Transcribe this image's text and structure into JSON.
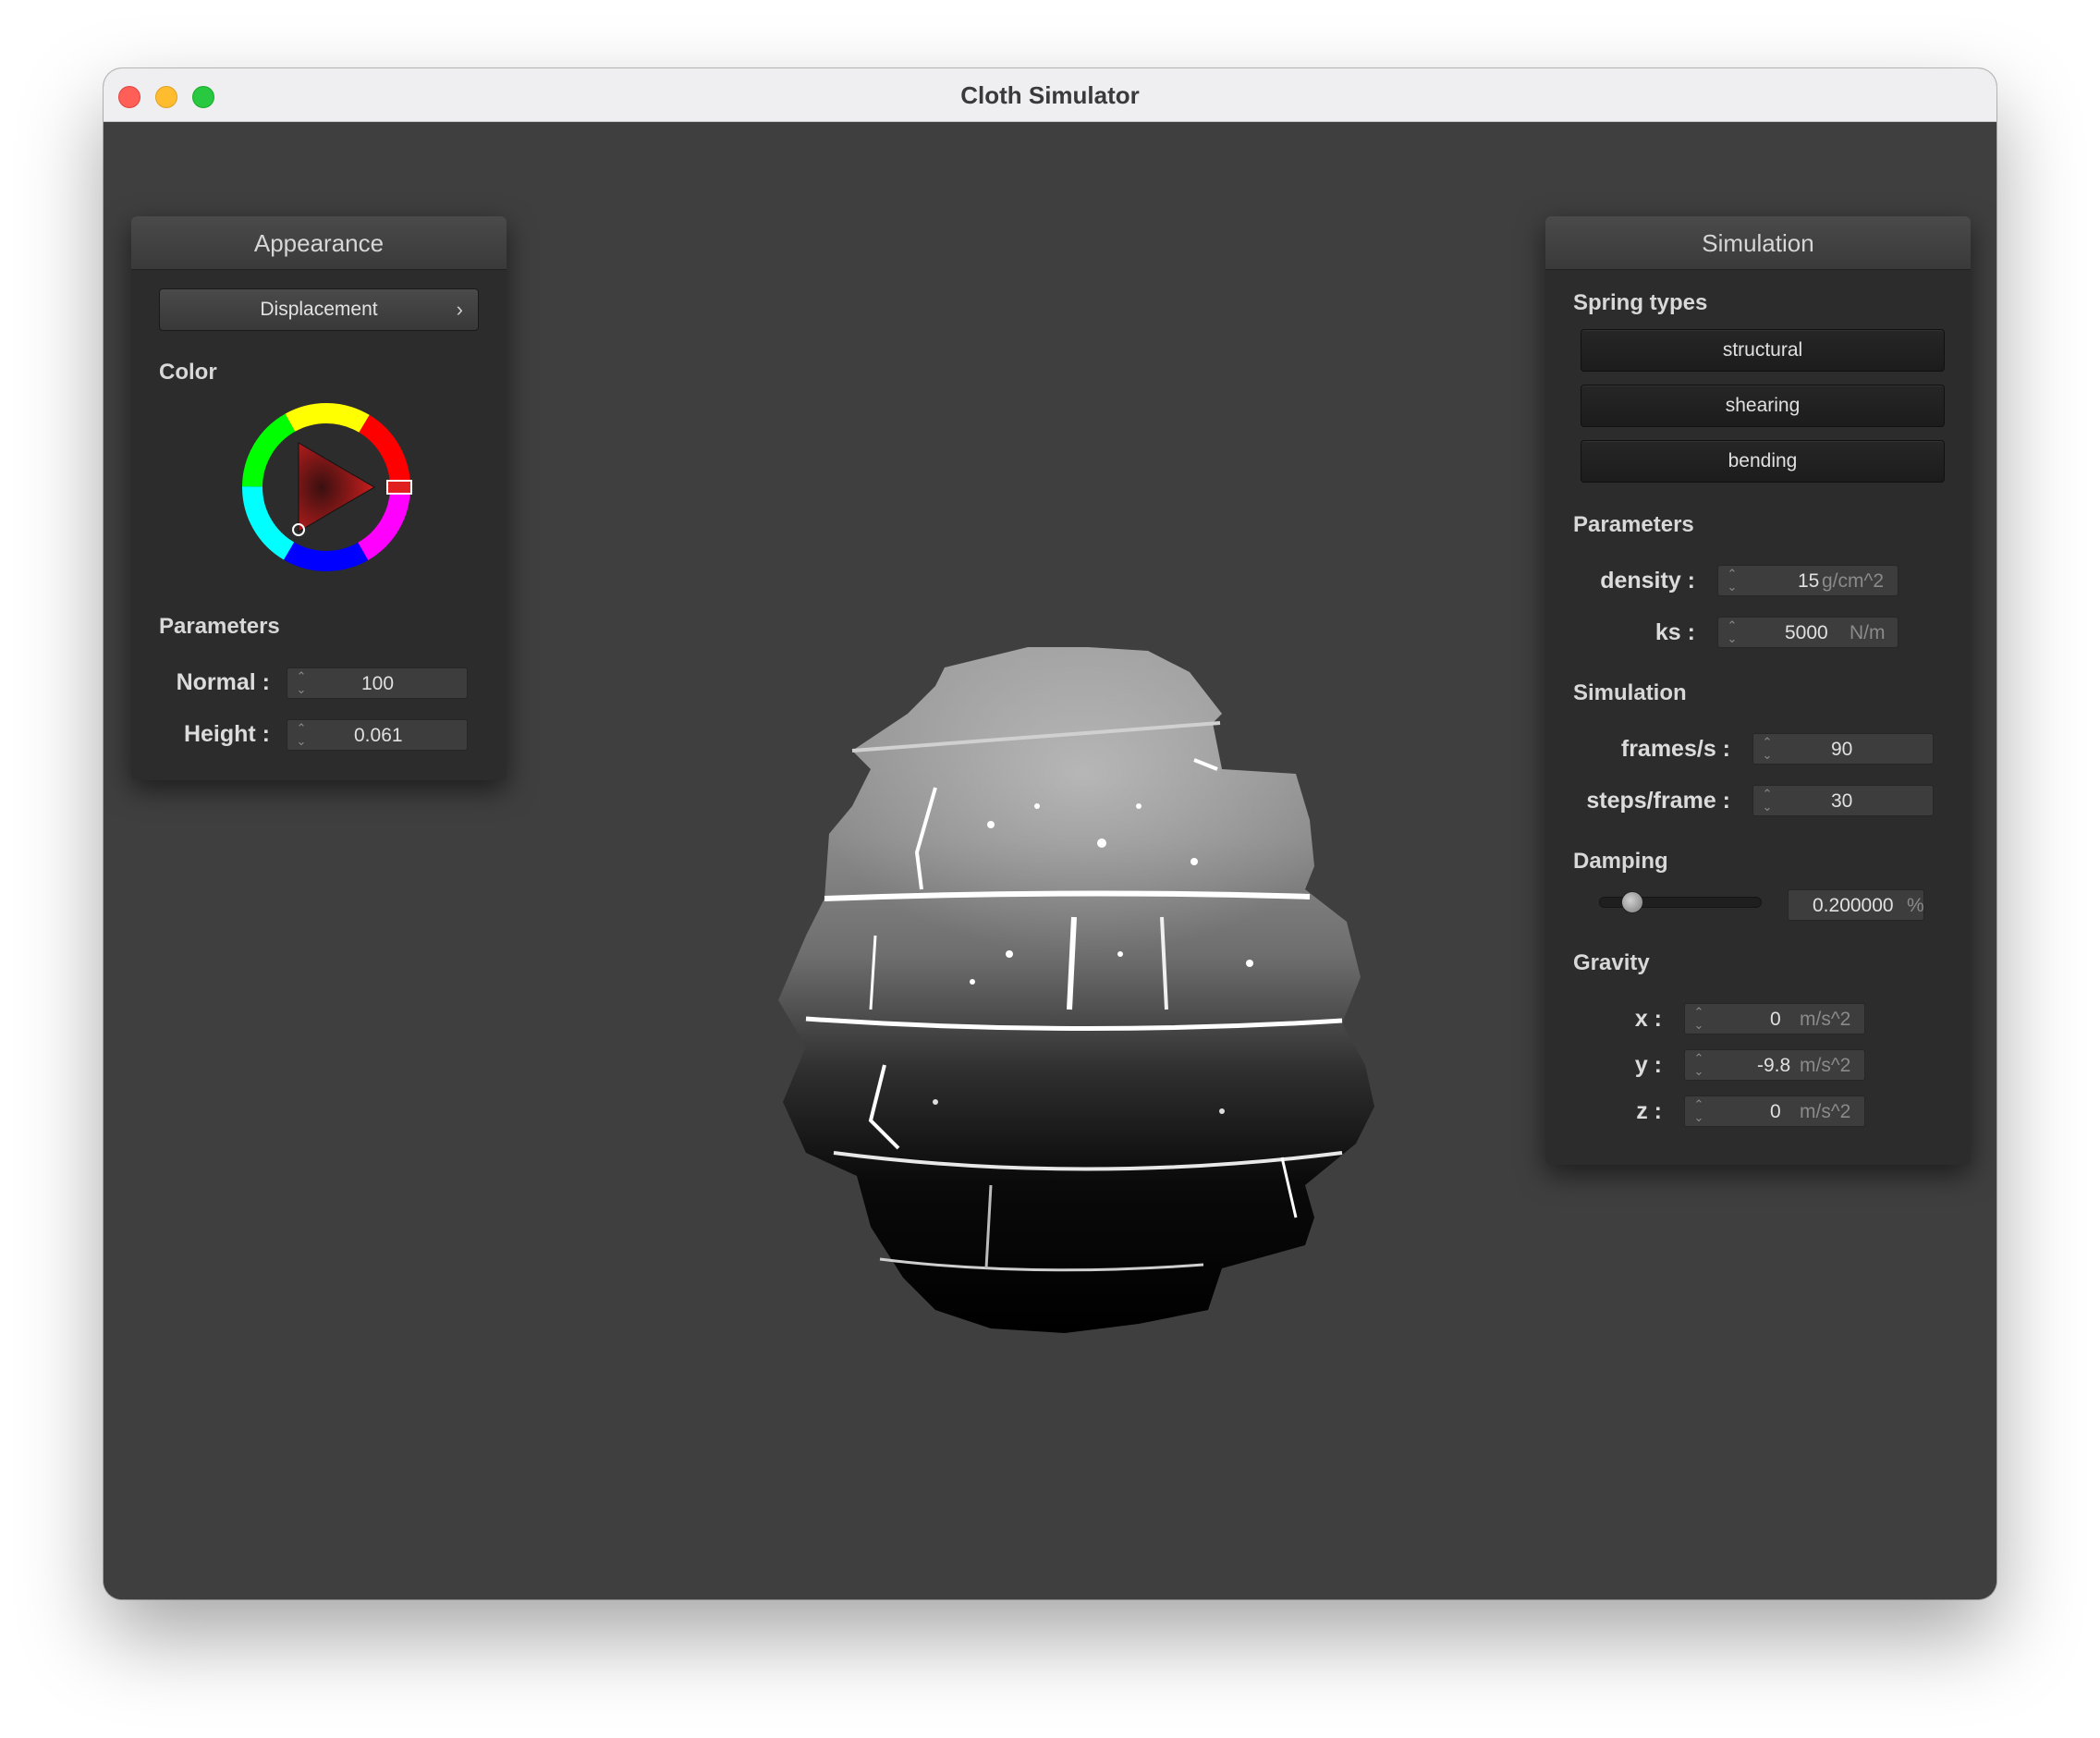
{
  "window": {
    "title": "Cloth Simulator"
  },
  "appearance": {
    "header": "Appearance",
    "shader_button": "Displacement",
    "chevron": "›",
    "color_label": "Color",
    "parameters_label": "Parameters",
    "normal": {
      "label": "Normal :",
      "value": "100"
    },
    "height": {
      "label": "Height :",
      "value": "0.061"
    },
    "selected_color": "#e02020"
  },
  "simulation_panel": {
    "header": "Simulation",
    "spring_types_label": "Spring types",
    "springs": [
      "structural",
      "shearing",
      "bending"
    ],
    "parameters_label": "Parameters",
    "density": {
      "label": "density :",
      "value": "15",
      "unit": "g/cm^2"
    },
    "ks": {
      "label": "ks :",
      "value": "5000",
      "unit": "N/m"
    },
    "simulation_label": "Simulation",
    "fps": {
      "label": "frames/s :",
      "value": "90"
    },
    "steps": {
      "label": "steps/frame :",
      "value": "30"
    },
    "damping_label": "Damping",
    "damping": {
      "value": "0.200000",
      "unit": "%",
      "level": 0.2
    },
    "gravity_label": "Gravity",
    "gravity": [
      {
        "label": "x :",
        "value": "0",
        "unit": "m/s^2"
      },
      {
        "label": "y :",
        "value": "-9.8",
        "unit": "m/s^2"
      },
      {
        "label": "z :",
        "value": "0",
        "unit": "m/s^2"
      }
    ]
  }
}
